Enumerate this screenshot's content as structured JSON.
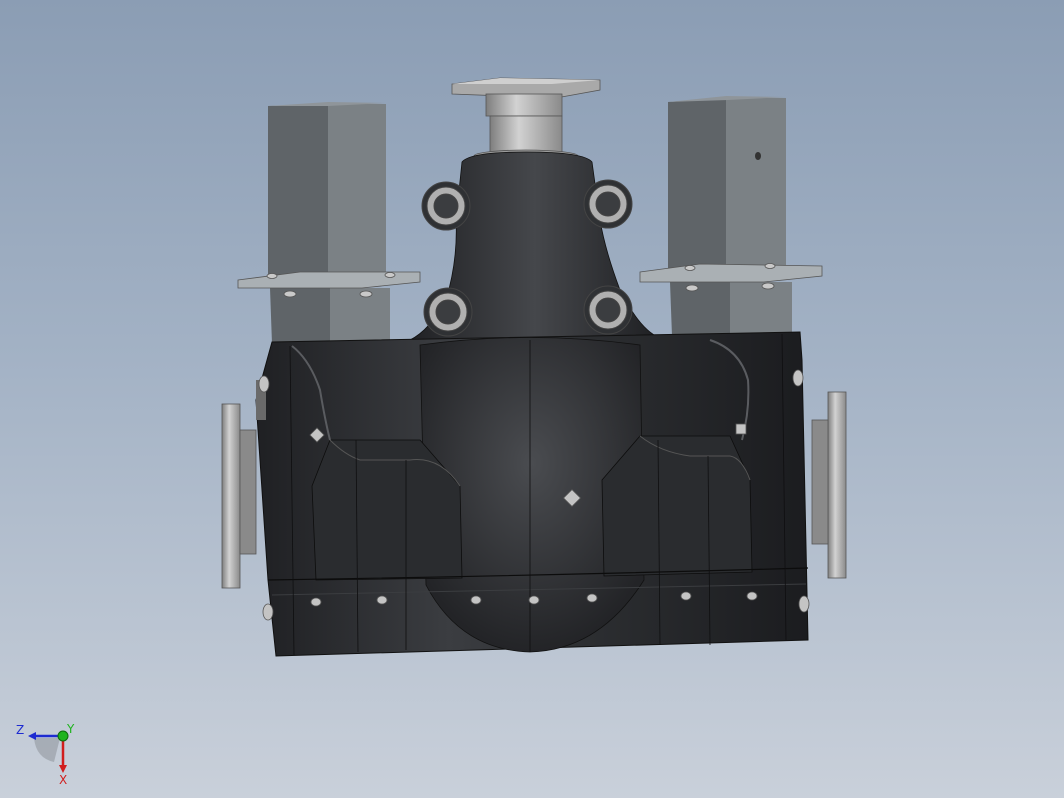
{
  "viewport": {
    "background_top": "#8b9db4",
    "background_bottom": "#c9d0da",
    "model_name": "",
    "body_color": "#2e3033",
    "metal_color": "#b9b9b9",
    "square_tube_color": "#6f7579"
  },
  "triad": {
    "z_label": "Z",
    "y_label": "Y",
    "x_label": "X",
    "z_color": "#1d2bd1",
    "y_color": "#1fb31f",
    "x_color": "#d11d1d"
  }
}
